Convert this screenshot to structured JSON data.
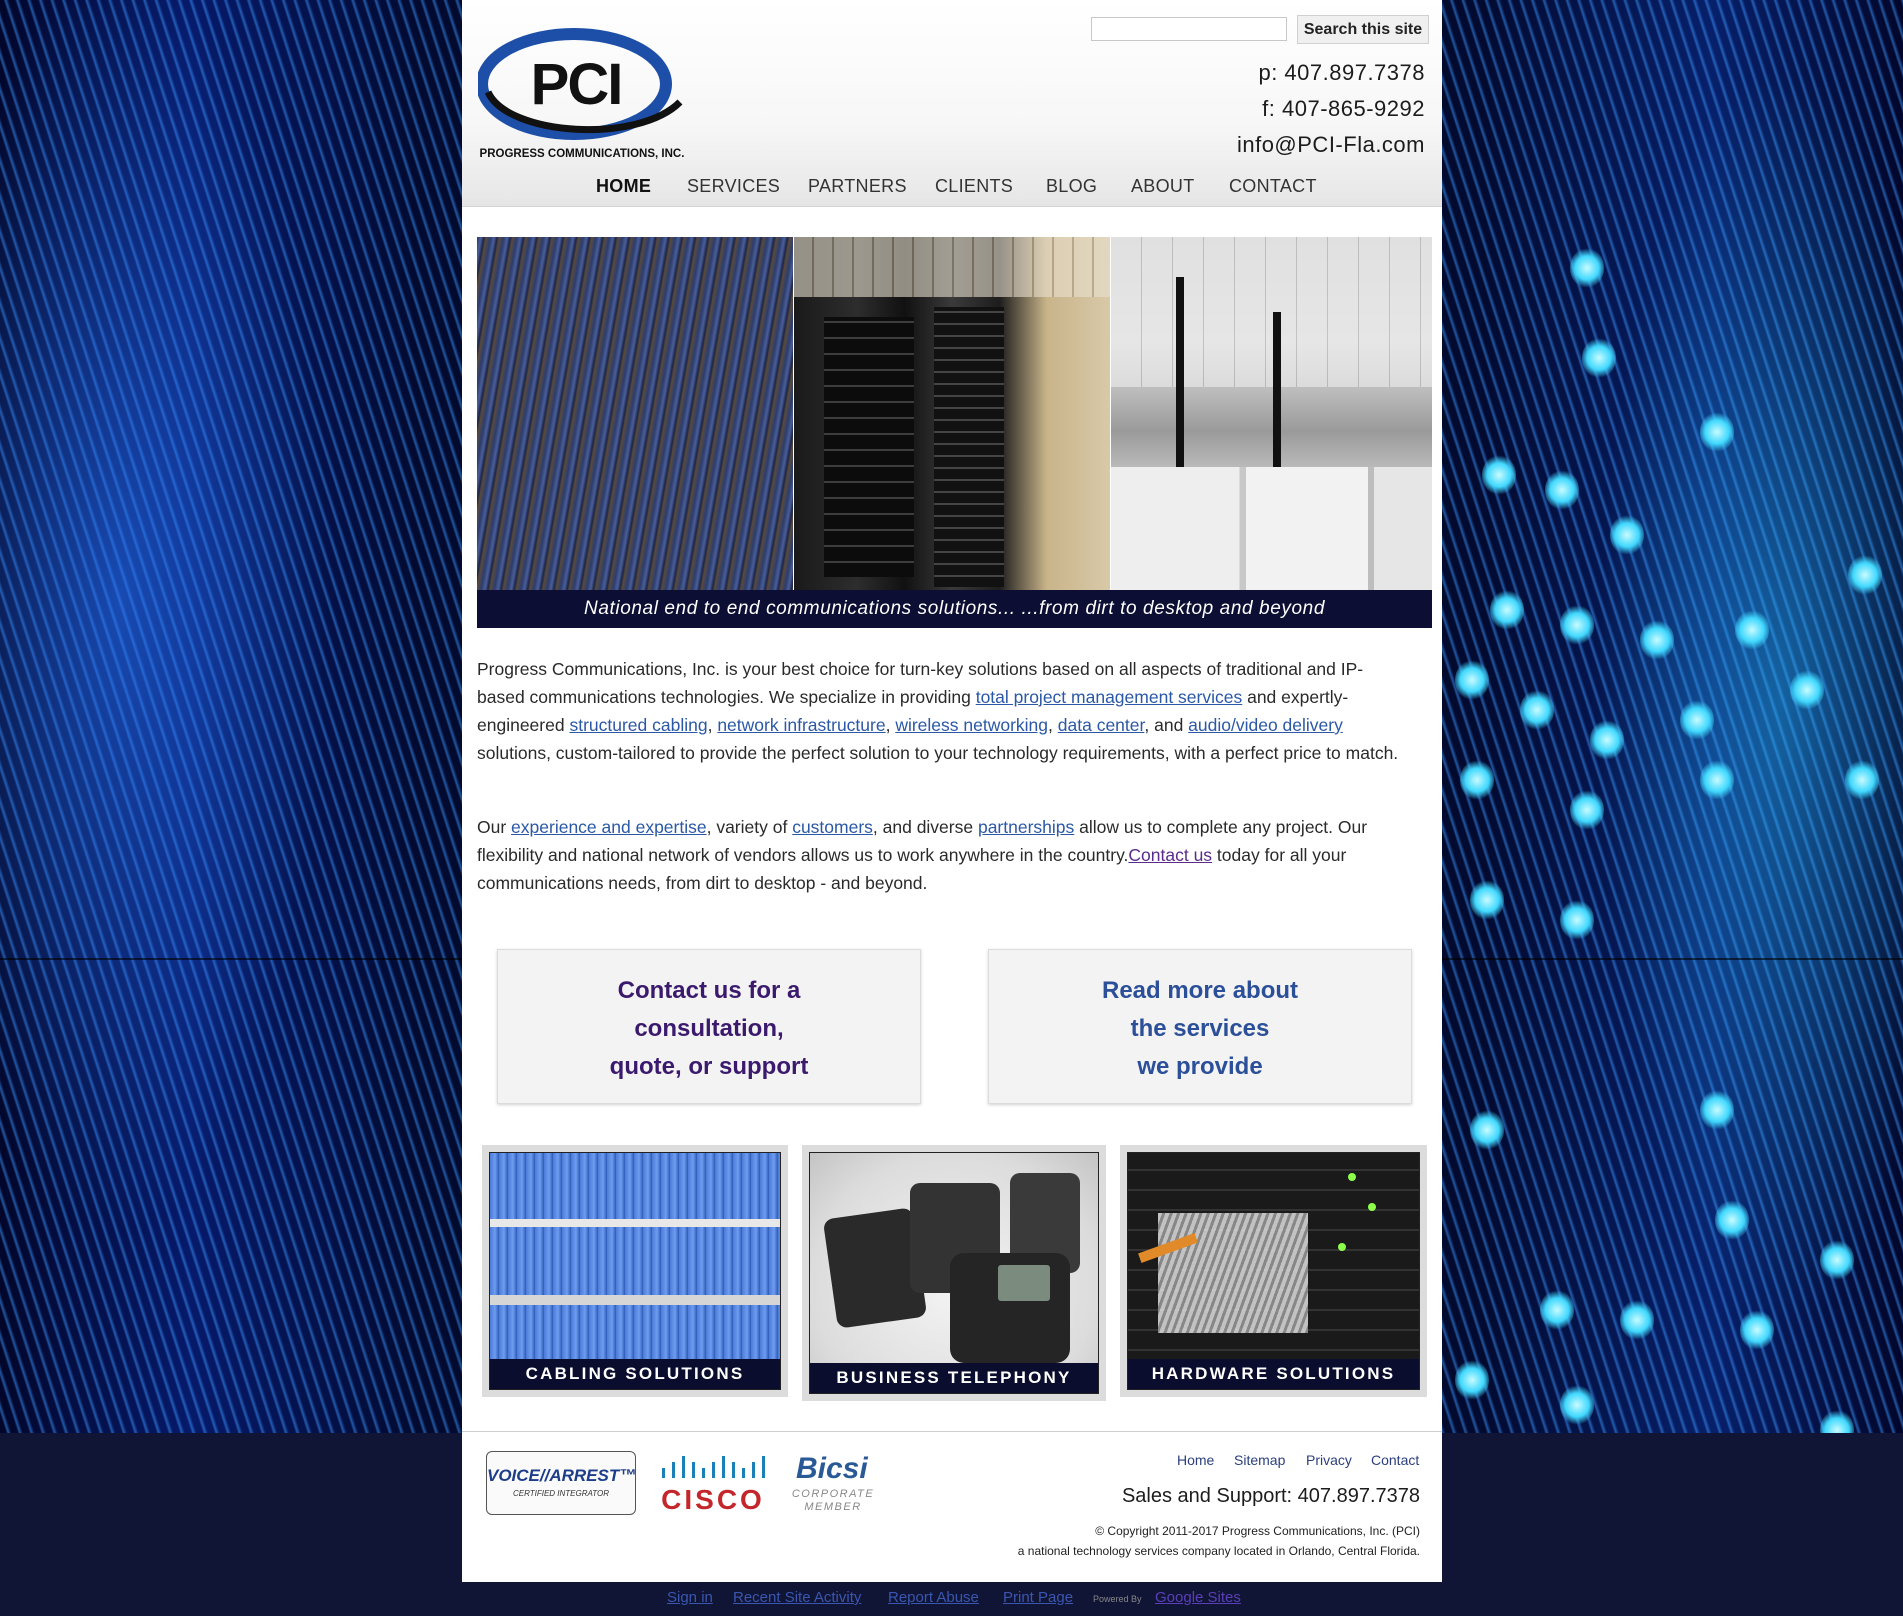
{
  "search": {
    "placeholder": "",
    "button_label": "Search this site"
  },
  "header": {
    "logo_text": "PCI",
    "logo_subtitle": "PROGRESS COMMUNICATIONS, INC.",
    "phone": "p: 407.897.7378",
    "fax": "f: 407-865-9292",
    "email": "info@PCI-Fla.com"
  },
  "nav": [
    {
      "label": "HOME",
      "active": true
    },
    {
      "label": "SERVICES",
      "active": false
    },
    {
      "label": "PARTNERS",
      "active": false
    },
    {
      "label": "CLIENTS",
      "active": false
    },
    {
      "label": "BLOG",
      "active": false
    },
    {
      "label": "ABOUT",
      "active": false
    },
    {
      "label": "CONTACT",
      "active": false
    }
  ],
  "hero": {
    "caption": "National end to end communications solutions... ...from dirt to desktop and beyond"
  },
  "intro": {
    "p1_a": "Progress Communications, Inc. is your best choice for turn-key solutions based on all aspects of traditional and IP-based communications technologies. We specialize in providing ",
    "link_total_pm": "total project management services",
    "p1_b": " and expertly-engineered ",
    "link_structured": "structured cabling",
    "sep1": ", ",
    "link_network": "network infrastructure",
    "sep2": ", ",
    "link_wireless": "wireless networking",
    "sep3": ", ",
    "link_datacenter": "data center",
    "sep4": ", and ",
    "link_av": "audio/video delivery",
    "p1_c": " solutions, custom-tailored to provide the perfect solution to your technology requirements, with a perfect price to match.",
    "p2_a": "Our ",
    "link_experience": "experience and expertise",
    "p2_b": ", variety of ",
    "link_customers": "customers",
    "p2_c": ", and diverse ",
    "link_partnerships": "partnerships",
    "p2_d": " allow us to complete any project. Our flexibility and national network of vendors allows us to work anywhere in the country.",
    "link_contact": "Contact us",
    "p2_e": " today for all your communications needs, from dirt to desktop - and beyond."
  },
  "cta": {
    "contact_line1": "Contact us for a",
    "contact_line2": "consultation,",
    "contact_line3": "quote, or support",
    "services_line1": "Read more about",
    "services_line2": "the services",
    "services_line3": "we provide"
  },
  "tiles": [
    {
      "label": "CABLING SOLUTIONS"
    },
    {
      "label": "BUSINESS TELEPHONY"
    },
    {
      "label": "HARDWARE SOLUTIONS"
    }
  ],
  "footer": {
    "links": [
      "Home",
      "Sitemap",
      "Privacy",
      "Contact"
    ],
    "sales": "Sales and Support: 407.897.7378",
    "copyright": "© Copyright 2011-2017 Progress Communications, Inc. (PCI)",
    "tagline": "a national technology services company located in Orlando, Central Florida.",
    "partner_logos": {
      "voicearrest": "VOICE//ARREST™",
      "voicearrest_sub": "CERTIFIED INTEGRATOR",
      "cisco": "CISCO",
      "bicsi": "Bicsi",
      "bicsi_sub1": "CORPORATE",
      "bicsi_sub2": "MEMBER"
    }
  },
  "bottom_bar": {
    "links": [
      "Sign in",
      "Recent Site Activity",
      "Report Abuse",
      "Print Page"
    ],
    "powered_by": "Powered By",
    "google_sites": "Google Sites"
  },
  "colors": {
    "accent_purple": "#3b1a6e",
    "accent_blue": "#2b4f98",
    "caption_bg": "#0c0e33"
  }
}
